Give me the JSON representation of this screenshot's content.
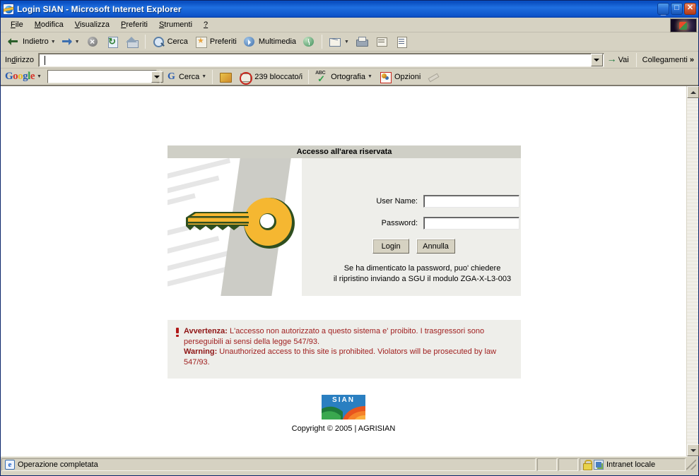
{
  "window": {
    "title": "Login SIAN - Microsoft Internet Explorer",
    "icon": "ie-icon",
    "minimize_label": "_",
    "maximize_label": "□",
    "close_label": "✕"
  },
  "menu": {
    "items": [
      {
        "label": "File",
        "accel": "F"
      },
      {
        "label": "Modifica",
        "accel": "M"
      },
      {
        "label": "Visualizza",
        "accel": "V"
      },
      {
        "label": "Preferiti",
        "accel": "P"
      },
      {
        "label": "Strumenti",
        "accel": "S"
      },
      {
        "label": "?",
        "accel": ""
      }
    ]
  },
  "toolbar": {
    "back_label": "Indietro",
    "search_label": "Cerca",
    "favorites_label": "Preferiti",
    "media_label": "Multimedia",
    "icons": [
      "back-icon",
      "forward-icon",
      "stop-icon",
      "refresh-icon",
      "home-icon",
      "search-icon",
      "favorites-icon",
      "media-icon",
      "history-icon",
      "mail-icon",
      "print-icon",
      "edit-icon",
      "discuss-icon"
    ]
  },
  "address_bar": {
    "label": "Indirizzo",
    "value": "",
    "placeholder": "",
    "go_label": "Vai",
    "links_label": "Collegamenti",
    "chevrons": "»"
  },
  "google_bar": {
    "logo": {
      "g1": "G",
      "o1": "o",
      "o2": "o",
      "g2": "g",
      "l": "l",
      "e": "e"
    },
    "search_value": "",
    "search_placeholder": "",
    "search_button_label": "Cerca",
    "blocked_label": "239 bloccato/i",
    "spelling_label": "Ortografia",
    "options_label": "Opzioni",
    "icons": [
      "google-g-icon",
      "popup-blocker-icon",
      "blocked-count-icon",
      "spellcheck-icon",
      "options-icon",
      "highlight-pencil-icon"
    ]
  },
  "login_panel": {
    "header": "Accesso all'area riservata",
    "username_label": "User Name:",
    "username_value": "",
    "password_label": "Password:",
    "password_value": "",
    "login_button": "Login",
    "cancel_button": "Annulla",
    "hint_line1": "Se ha dimenticato la password, puo' chiedere",
    "hint_line2": "il ripristino inviando a SGU il modulo ZGA-X-L3-003",
    "art_icon": "key-icon"
  },
  "warning": {
    "icon": "exclamation-icon",
    "it_title": "Avvertenza:",
    "it_text": " L'accesso non autorizzato a questo sistema e' proibito. I trasgressori sono perseguibili ai sensi della legge 547/93.",
    "en_title": "Warning:",
    "en_text": " Unauthorized access to this site is prohibited. Violators will be prosecuted by law 547/93."
  },
  "footer": {
    "logo_text": "SIAN",
    "copyright": "Copyright © 2005 | AGRISIAN"
  },
  "status_bar": {
    "message": "Operazione completata",
    "zone": "Intranet locale",
    "icons": [
      "ie-small-icon",
      "lock-icon",
      "zone-icon",
      "resize-grip-icon"
    ]
  },
  "colors": {
    "chrome": "#d6d2c2",
    "title_blue": "#0a53c6",
    "panel_bg": "#eeeeea",
    "panel_header": "#cfcfc6",
    "warning_red": "#a02020",
    "key_yellow": "#f5b731",
    "key_outline": "#2f4f1f",
    "sian_blue": "#2a7fc1",
    "sian_green": "#2e9e4a",
    "sian_orange": "#e8551e"
  }
}
